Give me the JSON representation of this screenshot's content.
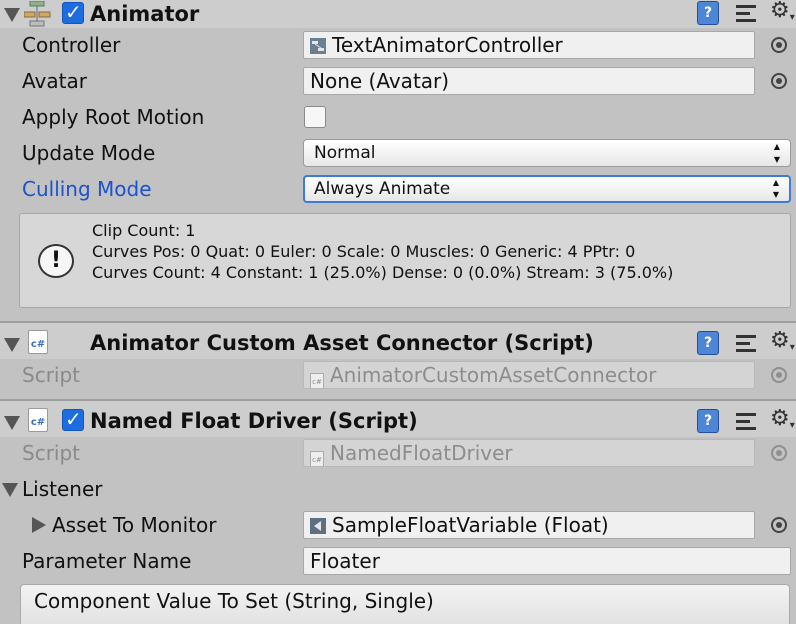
{
  "animator": {
    "title": "Animator",
    "enabled": true,
    "controller": {
      "label": "Controller",
      "value": "TextAnimatorController"
    },
    "avatar": {
      "label": "Avatar",
      "value": "None (Avatar)"
    },
    "apply_root_motion": {
      "label": "Apply Root Motion",
      "checked": false
    },
    "update_mode": {
      "label": "Update Mode",
      "value": "Normal"
    },
    "culling_mode": {
      "label": "Culling Mode",
      "value": "Always Animate"
    },
    "info": {
      "line1": "Clip Count: 1",
      "line2": "Curves Pos: 0 Quat: 0 Euler: 0 Scale: 0 Muscles: 0 Generic: 4 PPtr: 0",
      "line3": "Curves Count: 4 Constant: 1 (25.0%) Dense: 0 (0.0%) Stream: 3 (75.0%)"
    }
  },
  "connector": {
    "title": "Animator Custom Asset Connector (Script)",
    "script_label": "Script",
    "script_value": "AnimatorCustomAssetConnector"
  },
  "float_driver": {
    "title": "Named Float Driver (Script)",
    "enabled": true,
    "script_label": "Script",
    "script_value": "NamedFloatDriver",
    "listener_label": "Listener",
    "asset_label": "Asset To Monitor",
    "asset_value": "SampleFloatVariable (Float)",
    "param_label": "Parameter Name",
    "param_value": "Floater",
    "component_value_header": "Component Value To Set (String, Single)"
  },
  "icons": {
    "help": "?",
    "cs": "c#",
    "gear": "⚙",
    "gear_caret": "▾",
    "check": "✓",
    "warning": "!",
    "dropdown_arrow": "▲▼"
  },
  "colors": {
    "accent_blue": "#1a52d0",
    "background": "#c2c2c2"
  }
}
